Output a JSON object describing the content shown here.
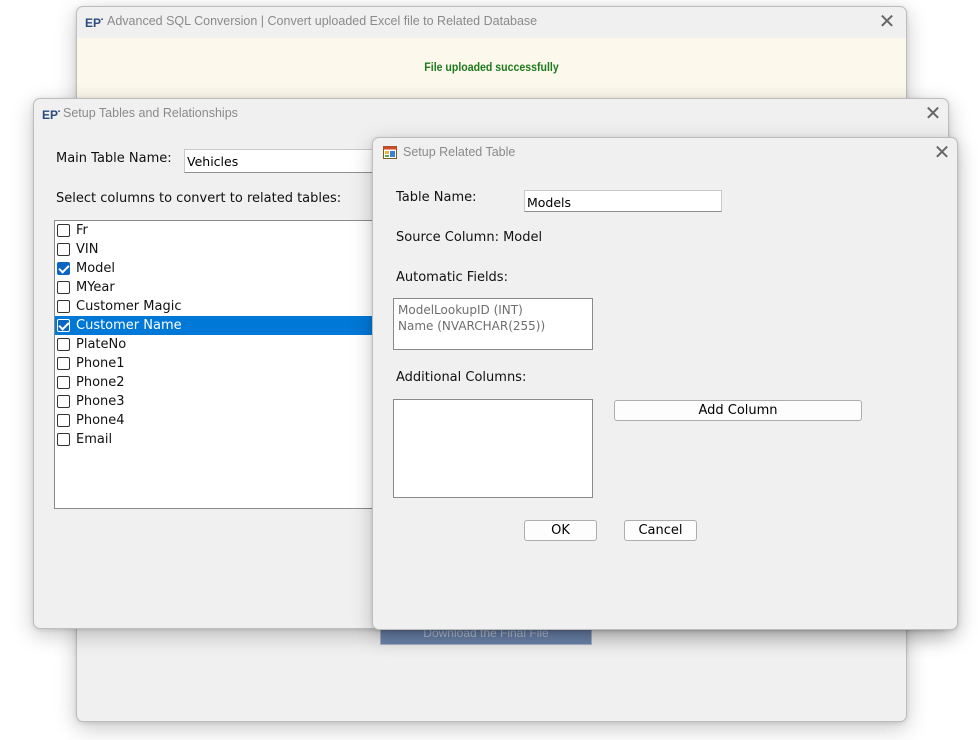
{
  "background_window": {
    "title": "Advanced SQL Conversion | Convert uploaded Excel file to Related Database",
    "status_message": "File uploaded successfully",
    "download_button_label": "Download the Final File",
    "close_glyph": "✕"
  },
  "setup_window": {
    "title": "Setup Tables and Relationships",
    "main_table_label": "Main Table Name:",
    "main_table_value": "Vehicles",
    "columns_prompt": "Select columns to convert to related tables:",
    "close_glyph": "✕",
    "columns": [
      {
        "label": "Fr",
        "checked": false,
        "selected": false
      },
      {
        "label": "VIN",
        "checked": false,
        "selected": false
      },
      {
        "label": "Model",
        "checked": true,
        "selected": false
      },
      {
        "label": "MYear",
        "checked": false,
        "selected": false
      },
      {
        "label": "Customer Magic",
        "checked": false,
        "selected": false
      },
      {
        "label": "Customer Name",
        "checked": true,
        "selected": true
      },
      {
        "label": "PlateNo",
        "checked": false,
        "selected": false
      },
      {
        "label": "Phone1",
        "checked": false,
        "selected": false
      },
      {
        "label": "Phone2",
        "checked": false,
        "selected": false
      },
      {
        "label": "Phone3",
        "checked": false,
        "selected": false
      },
      {
        "label": "Phone4",
        "checked": false,
        "selected": false
      },
      {
        "label": "Email",
        "checked": false,
        "selected": false
      }
    ]
  },
  "related_window": {
    "title": "Setup Related Table",
    "close_glyph": "✕",
    "table_name_label": "Table Name:",
    "table_name_value": "Models",
    "source_column_text": "Source Column: Model",
    "automatic_fields_label": "Automatic Fields:",
    "automatic_fields": [
      "ModelLookupID (INT)",
      "Name (NVARCHAR(255))"
    ],
    "additional_columns_label": "Additional Columns:",
    "add_column_label": "Add Column",
    "ok_label": "OK",
    "cancel_label": "Cancel"
  },
  "colors": {
    "selection": "#0078d7",
    "check": "#0a66c2",
    "success_text": "#1d7a1d",
    "success_bar": "#fcf8ec"
  }
}
